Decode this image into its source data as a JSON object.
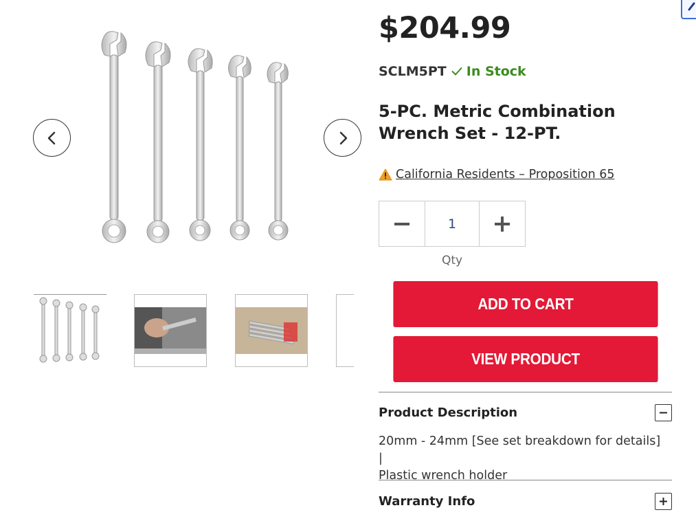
{
  "product": {
    "price": "$204.99",
    "sku": "SCLM5PT",
    "stock_status": "In Stock",
    "title_line1": "5-PC. Metric Combination",
    "title_line2": "Wrench Set - 12-PT.",
    "prop65_link": "California Residents – Proposition 65"
  },
  "quantity": {
    "value": "1",
    "label": "Qty"
  },
  "actions": {
    "add_to_cart": "ADD TO CART",
    "view_product": "VIEW PRODUCT"
  },
  "accordions": [
    {
      "title": "Product Description",
      "expanded": true,
      "body_line1": "20mm - 24mm [See set breakdown for details] |",
      "body_line2": "Plastic wrench holder"
    },
    {
      "title": "Warranty Info",
      "expanded": false
    }
  ],
  "colors": {
    "button_red": "#e31937",
    "in_stock_green": "#3b8c1d",
    "warning_orange": "#f0a020",
    "thumb_active": "#2d4a7a"
  },
  "icons": {
    "prev": "chevron-left-icon",
    "next": "chevron-right-icon",
    "check": "checkmark-icon",
    "warning": "warning-triangle-icon",
    "minus": "minus-icon",
    "plus": "plus-icon"
  }
}
